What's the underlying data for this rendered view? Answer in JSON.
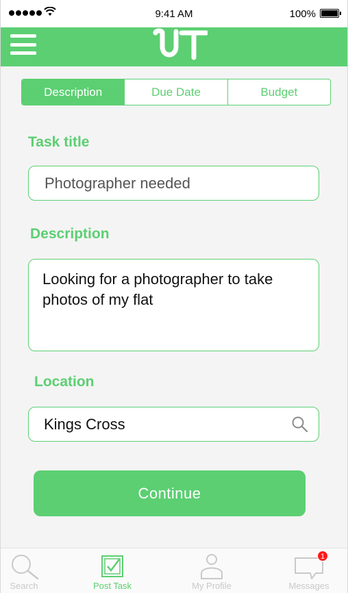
{
  "status_bar": {
    "time": "9:41 AM",
    "battery_percent": "100%",
    "battery_level": 1.0
  },
  "header": {
    "logo": "UT",
    "menu_icon": "hamburger-icon"
  },
  "tabs": [
    {
      "label": "Description",
      "active": true
    },
    {
      "label": "Due Date",
      "active": false
    },
    {
      "label": "Budget",
      "active": false
    }
  ],
  "form": {
    "task_title_label": "Task title",
    "task_title_value": "Photographer needed",
    "description_label": "Description",
    "description_value": "Looking for a photographer to take photos of my flat",
    "location_label": "Location",
    "location_value": "Kings Cross",
    "location_icon": "search-icon"
  },
  "continue_label": "Continue",
  "tab_bar": {
    "items": [
      {
        "label": "Search",
        "icon": "search-icon",
        "active": false
      },
      {
        "label": "Post Task",
        "icon": "checkbox-icon",
        "active": true
      },
      {
        "label": "My Profile",
        "icon": "person-icon",
        "active": false
      },
      {
        "label": "Messages",
        "icon": "chat-bubble-icon",
        "active": false,
        "badge": "1"
      }
    ]
  },
  "colors": {
    "accent": "#5ccf72",
    "badge": "#ff1a1a",
    "inactive": "#c9c9c9"
  }
}
